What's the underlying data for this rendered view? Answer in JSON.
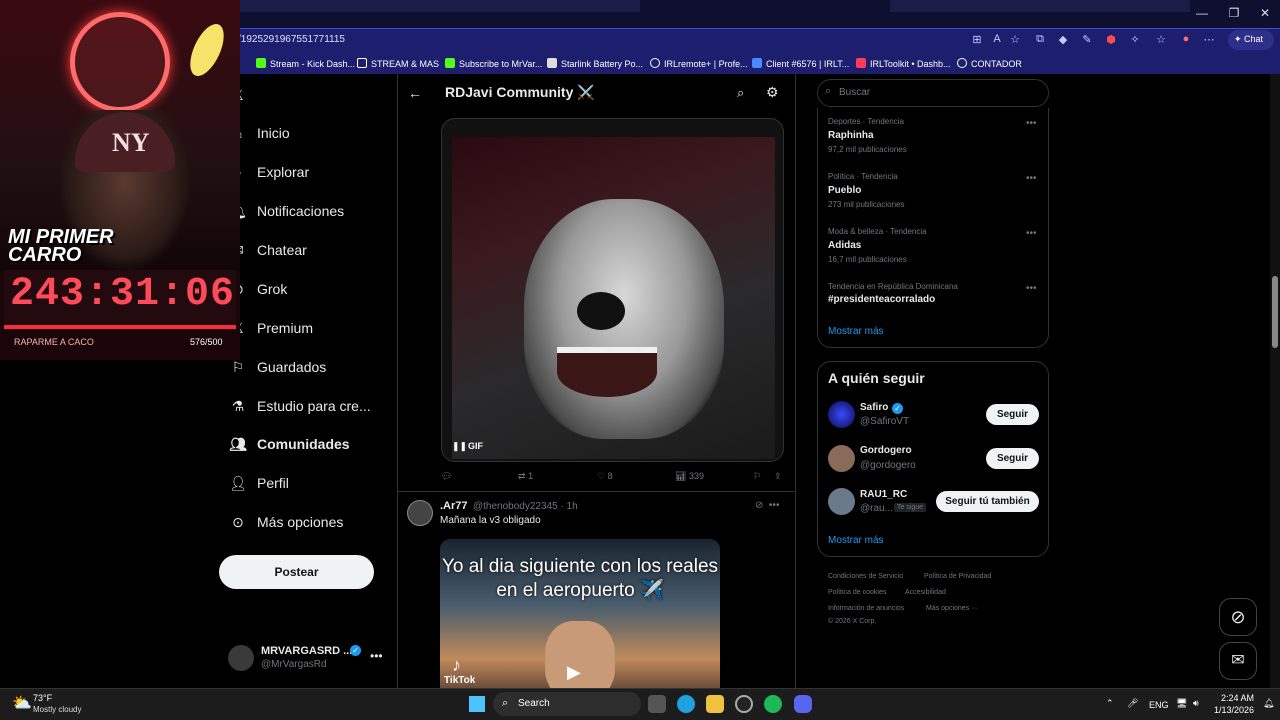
{
  "browser": {
    "url": "/1925291967551771115",
    "chat_label": "Chat",
    "bookmarks": [
      "Stream - Kick Dash...",
      "STREAM & MAS",
      "Subscribe to MrVar...",
      "Starlink Battery Po...",
      "IRLremote+ | Profe...",
      "Client #6576 | IRLT...",
      "IRLToolkit • Dashb...",
      "CONTADOR"
    ]
  },
  "overlay": {
    "title_line1": "MI PRIMER",
    "title_line2": "CARRO",
    "timer": "243:31:06",
    "goal_label": "RAPARME A CACO",
    "goal_count": "576/500",
    "cap_logo": "NY"
  },
  "nav": {
    "items": [
      {
        "label": "Inicio",
        "icon": "home-icon"
      },
      {
        "label": "Explorar",
        "icon": "search-icon"
      },
      {
        "label": "Notificaciones",
        "icon": "bell-icon"
      },
      {
        "label": "Chatear",
        "icon": "mail-icon"
      },
      {
        "label": "Grok",
        "icon": "grok-icon"
      },
      {
        "label": "Premium",
        "icon": "x-logo-icon"
      },
      {
        "label": "Guardados",
        "icon": "bookmark-icon"
      },
      {
        "label": "Estudio para cre...",
        "icon": "flask-icon"
      },
      {
        "label": "Comunidades",
        "icon": "communities-icon"
      },
      {
        "label": "Perfil",
        "icon": "person-icon"
      },
      {
        "label": "Más opciones",
        "icon": "more-circle-icon"
      }
    ],
    "post_button": "Postear",
    "account": {
      "name": "MRVARGASRD ...",
      "handle": "@MrVargasRd"
    }
  },
  "feed": {
    "title": "RDJavi Community ⚔️",
    "post1": {
      "gif_label": "GIF",
      "replies": "",
      "reposts": "1",
      "likes": "8",
      "views": "339"
    },
    "post2": {
      "name": ".Ar77",
      "handle_time": "@thenobody22345 · 1h",
      "text": "Mañana la v3  obligado",
      "video_caption": "Yo al dia siguiente con los reales en el aeropuerto ✈️",
      "video_source": "TikTok"
    }
  },
  "right": {
    "search_placeholder": "Buscar",
    "trends": [
      {
        "meta": "Deportes · Tendencia",
        "name": "Raphinha",
        "count": "97,2 mil publicaciones"
      },
      {
        "meta": "Política · Tendencia",
        "name": "Pueblo",
        "count": "273 mil publicaciones"
      },
      {
        "meta": "Moda & belleza · Tendencia",
        "name": "Adidas",
        "count": "16,7 mil publicaciones"
      },
      {
        "meta": "Tendencia en República Dominicana",
        "name": "#presidenteacorralado",
        "count": ""
      }
    ],
    "show_more": "Mostrar más",
    "who_to_follow_title": "A quién seguir",
    "follow": [
      {
        "name": "Safiro",
        "handle": "@SafiroVT",
        "button": "Seguir"
      },
      {
        "name": "Gordogero",
        "handle": "@gordogero",
        "button": "Seguir"
      },
      {
        "name": "RAU1_RC",
        "handle": "@rau...",
        "button": "Seguir tú también",
        "badge": "Te sigue"
      }
    ],
    "footer": [
      "Condiciones de Servicio",
      "Política de Privacidad",
      "Política de cookies",
      "Accesibilidad",
      "Información de anuncios",
      "Más opciones ···",
      "© 2026 X Corp."
    ]
  },
  "taskbar": {
    "temp": "73°F",
    "condition": "Mostly cloudy",
    "search_label": "Search",
    "lang": "ENG",
    "time": "2:24 AM",
    "date": "1/13/2026"
  }
}
